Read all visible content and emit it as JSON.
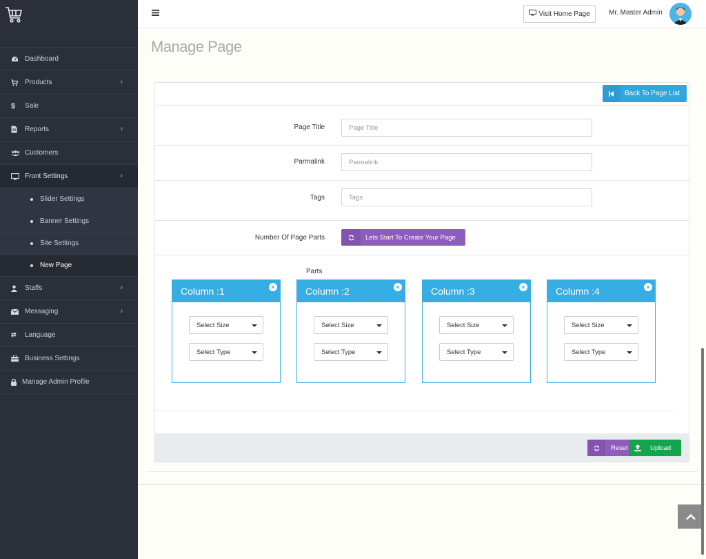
{
  "header": {
    "visit_home_label": "Visit Home Page",
    "admin_name": "Mr. Master Admin"
  },
  "sidebar": {
    "items": [
      {
        "label": "Dashboard",
        "icon": "dashboard-icon"
      },
      {
        "label": "Products",
        "icon": "cart-icon"
      },
      {
        "label": "Sale",
        "icon": "dollar-icon"
      },
      {
        "label": "Reports",
        "icon": "document-icon"
      },
      {
        "label": "Customers",
        "icon": "users-icon"
      },
      {
        "label": "Front Settings",
        "icon": "monitor-icon"
      }
    ],
    "front_settings_sub": [
      {
        "label": "Slider Settings"
      },
      {
        "label": "Banner Settings"
      },
      {
        "label": "Site Settings"
      },
      {
        "label": "New Page"
      }
    ],
    "items_after": [
      {
        "label": "Staffs",
        "icon": "user-icon"
      },
      {
        "label": "Messaging",
        "icon": "envelope-icon"
      },
      {
        "label": "Language",
        "icon": "language-icon"
      },
      {
        "label": "Business Settings",
        "icon": "briefcase-icon"
      },
      {
        "label": "Manage Admin Profile",
        "icon": "lock-icon"
      }
    ]
  },
  "main": {
    "title": "Manage Page",
    "back_button": "Back To Page List",
    "form": {
      "page_title_label": "Page Title",
      "page_title_placeholder": "Page Title",
      "permalink_label": "Parmalink",
      "permalink_placeholder": "Parmalink",
      "tags_label": "Tags",
      "tags_placeholder": "Tags",
      "parts_count_label": "Number Of Page Parts",
      "start_button": "Lets Start To Create Your Page",
      "parts_label": "Parts"
    },
    "columns": [
      {
        "title": "Column :1",
        "size": "Select Size",
        "type": "Select Type"
      },
      {
        "title": "Column :2",
        "size": "Select Size",
        "type": "Select Type"
      },
      {
        "title": "Column :3",
        "size": "Select Size",
        "type": "Select Type"
      },
      {
        "title": "Column :4",
        "size": "Select Size",
        "type": "Select Type"
      }
    ],
    "reset_label": "Reset",
    "upload_label": "Upload"
  },
  "colors": {
    "sidebar_bg": "#2b2f3a",
    "accent_blue": "#36aee3",
    "purple": "#8e5cbc",
    "green": "#13a54d"
  }
}
